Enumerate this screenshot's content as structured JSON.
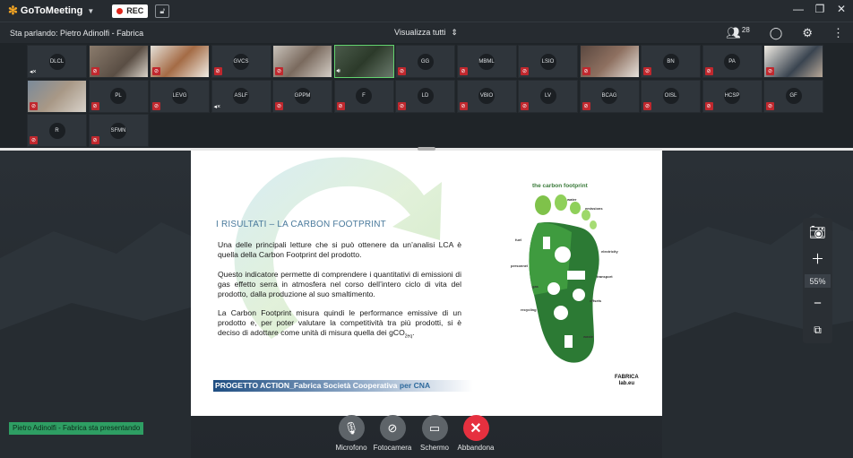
{
  "app": {
    "name": "GoToMeeting",
    "rec_label": "REC"
  },
  "infobar": {
    "speaking": "Sta parlando: Pietro Adinolfi - Fabrica",
    "view_all": "Visualizza tutti",
    "participants_count": "28"
  },
  "participants": [
    {
      "initials": "DLCL",
      "video": false,
      "audio": "off-x"
    },
    {
      "initials": "",
      "video": true,
      "audio": "muted"
    },
    {
      "initials": "",
      "video": true,
      "audio": "muted"
    },
    {
      "initials": "GVCS",
      "video": false,
      "audio": "muted"
    },
    {
      "initials": "",
      "video": true,
      "audio": "muted"
    },
    {
      "initials": "",
      "video": true,
      "audio": "speaking"
    },
    {
      "initials": "GG",
      "video": false,
      "audio": "muted"
    },
    {
      "initials": "MBML",
      "video": false,
      "audio": "muted"
    },
    {
      "initials": "LSIO",
      "video": false,
      "audio": "muted"
    },
    {
      "initials": "",
      "video": true,
      "audio": "muted"
    },
    {
      "initials": "BN",
      "video": false,
      "audio": "muted"
    },
    {
      "initials": "PA",
      "video": false,
      "audio": "muted"
    },
    {
      "initials": "",
      "video": true,
      "audio": "muted"
    },
    {
      "initials": "",
      "video": true,
      "audio": "muted"
    },
    {
      "initials": "PL",
      "video": false,
      "audio": "muted"
    },
    {
      "initials": "LEVG",
      "video": false,
      "audio": "muted"
    },
    {
      "initials": "ASLF",
      "video": false,
      "audio": "off-x"
    },
    {
      "initials": "GPPM",
      "video": false,
      "audio": "muted"
    },
    {
      "initials": "F",
      "video": false,
      "audio": "muted"
    },
    {
      "initials": "LD",
      "video": false,
      "audio": "muted"
    },
    {
      "initials": "VBIO",
      "video": false,
      "audio": "muted"
    },
    {
      "initials": "LV",
      "video": false,
      "audio": "muted"
    },
    {
      "initials": "BCAG",
      "video": false,
      "audio": "muted"
    },
    {
      "initials": "OISL",
      "video": false,
      "audio": "muted"
    },
    {
      "initials": "HCSP",
      "video": false,
      "audio": "muted"
    },
    {
      "initials": "GF",
      "video": false,
      "audio": "muted"
    },
    {
      "initials": "R",
      "video": false,
      "audio": "muted"
    },
    {
      "initials": "SFMN",
      "video": false,
      "audio": "muted"
    }
  ],
  "slide": {
    "title": "I RISULTATI – LA CARBON FOOTPRINT",
    "p1": "Una delle principali letture che si può ottenere da un’analisi LCA è quella della Carbon Footprint del prodotto.",
    "p2": "Questo indicatore permette di comprendere i quantitativi di emissioni di gas effetto serra in atmosfera nel corso dell’intero ciclo di vita del prodotto, dalla produzione al suo smaltimento.",
    "p3": "La Carbon Footprint misura quindi le performance emissive di un prodotto e, per poter valutare la competitività tra più prodotti, si è deciso di adottare come unità di misura quella dei gCO",
    "p3_sub": "2eq",
    "p3_end": ".",
    "footer_main": "PROGETTO ACTION_Fabrica Società Cooperativa",
    "footer_cna": " per CNA",
    "fabrica_logo": "FABRICA",
    "fabrica_logo_sub": "lab.eu",
    "cf_title": "the carbon footprint",
    "cf_labels": {
      "water": "water",
      "emissions": "emissions",
      "fuel": "fuel",
      "electricity": "electricity",
      "personnel": "personnel",
      "transport": "transport",
      "gas": "gas",
      "offsets": "offsets",
      "recycling": "recycling",
      "waste": "waste"
    }
  },
  "zoom": {
    "level": "55%"
  },
  "presenter_label": "Pietro Adinolfi - Fabrica sta presentando",
  "controls": {
    "mic": "Microfono",
    "camera": "Fotocamera",
    "screen": "Schermo",
    "leave": "Abbandona"
  },
  "colors": {
    "mute_red": "#c0282e",
    "presenter_green": "#2e9e63",
    "leave_red": "#e6303f"
  }
}
